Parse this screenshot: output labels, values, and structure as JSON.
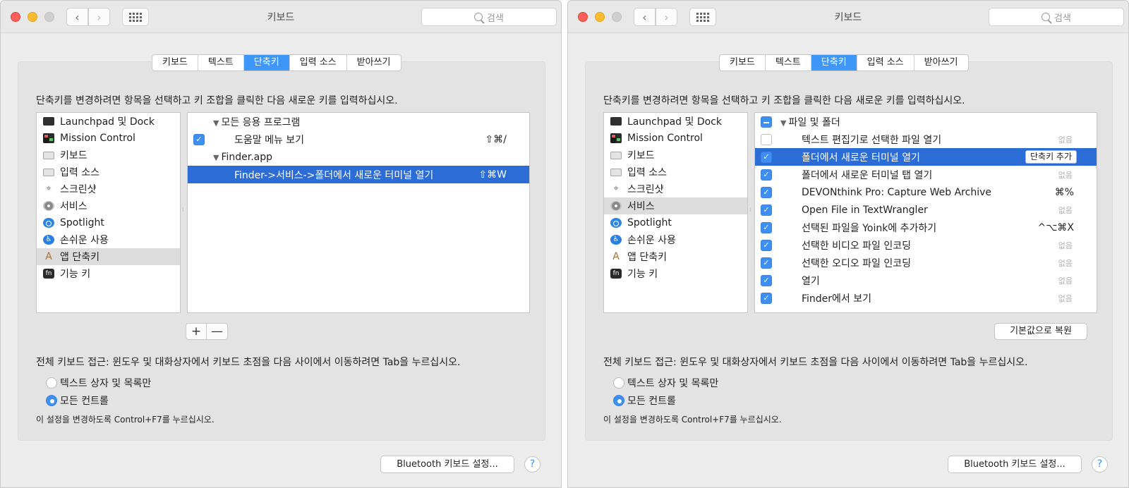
{
  "window_title": "키보드",
  "search_placeholder": "검색",
  "tabs": [
    "키보드",
    "텍스트",
    "단축키",
    "입력 소스",
    "받아쓰기"
  ],
  "active_tab": "단축키",
  "instruction": "단축키를 변경하려면 항목을 선택하고 키 조합을 클릭한 다음 새로운 키를 입력하십시오.",
  "categories": [
    {
      "label": "Launchpad 및 Dock",
      "icon": "launchpad-icon"
    },
    {
      "label": "Mission Control",
      "icon": "mission-control-icon"
    },
    {
      "label": "키보드",
      "icon": "keyboard-icon"
    },
    {
      "label": "입력 소스",
      "icon": "input-source-icon"
    },
    {
      "label": "스크린샷",
      "icon": "screenshot-icon"
    },
    {
      "label": "서비스",
      "icon": "gear-icon"
    },
    {
      "label": "Spotlight",
      "icon": "spotlight-icon"
    },
    {
      "label": "손쉬운 사용",
      "icon": "accessibility-icon"
    },
    {
      "label": "앱 단축키",
      "icon": "app-shortcuts-icon"
    },
    {
      "label": "기능 키",
      "icon": "fn-icon"
    }
  ],
  "left": {
    "selected_category": "앱 단축키",
    "rows": [
      {
        "type": "group",
        "label": "모든 응용 프로그램"
      },
      {
        "type": "item",
        "checked": true,
        "label": "도움말 메뉴 보기",
        "keys": "⇧⌘/"
      },
      {
        "type": "group",
        "label": "Finder.app"
      },
      {
        "type": "item",
        "label": "Finder->서비스->폴더에서 새로운 터미널 열기",
        "keys": "⇧⌘W",
        "highlighted": true
      }
    ],
    "add_label": "+",
    "remove_label": "—"
  },
  "right": {
    "selected_category": "서비스",
    "group_label": "파일 및 폴더",
    "rows": [
      {
        "checked": false,
        "label": "텍스트 편집기로 선택한 파일 열기",
        "keys": "없음"
      },
      {
        "checked": true,
        "label": "폴더에서 새로운 터미널 열기",
        "keys": "",
        "highlighted": true,
        "button": "단축키 추가"
      },
      {
        "checked": true,
        "label": "폴더에서 새로운 터미널 탭 열기",
        "keys": "없음"
      },
      {
        "checked": true,
        "label": "DEVONthink Pro: Capture Web Archive",
        "keys": "⌘%"
      },
      {
        "checked": true,
        "label": "Open File in TextWrangler",
        "keys": "없음"
      },
      {
        "checked": true,
        "label": "선택된 파일을 Yoink에 추가하기",
        "keys": "^⌥⌘X"
      },
      {
        "checked": true,
        "label": "선택한 비디오 파일 인코딩",
        "keys": "없음"
      },
      {
        "checked": true,
        "label": "선택한 오디오 파일 인코딩",
        "keys": "없음"
      },
      {
        "checked": true,
        "label": "열기",
        "keys": "없음"
      },
      {
        "checked": true,
        "label": "Finder에서 보기",
        "keys": "없음"
      }
    ],
    "restore_label": "기본값으로 복원"
  },
  "keyboard_access": "전체 키보드 접근: 윈도우 및 대화상자에서 키보드 초점을 다음 사이에서 이동하려면 Tab을 누르십시오.",
  "radio_options": [
    "텍스트 상자 및 목록만",
    "모든 컨트롤"
  ],
  "radio_selected": "모든 컨트롤",
  "hint": "이 설정을 변경하도록 Control+F7를 누르십시오.",
  "bluetooth_button": "Bluetooth 키보드 설정...",
  "help_label": "?",
  "colors": {
    "accent": "#3d8ff2",
    "highlight": "#2c6cd6"
  }
}
